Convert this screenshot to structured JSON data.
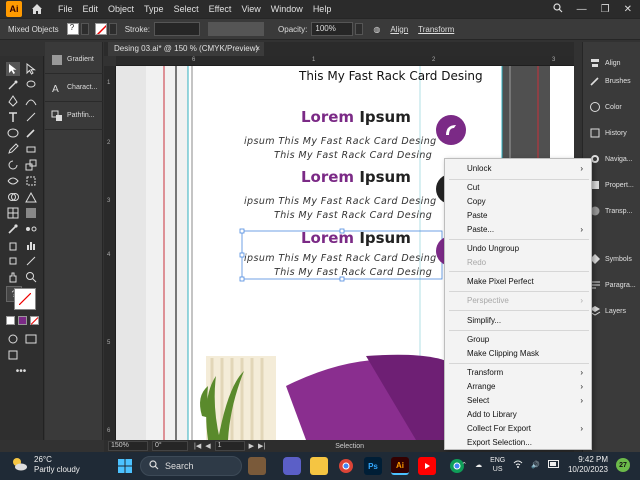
{
  "app": {
    "logo_text": "Ai",
    "menu": [
      "File",
      "Edit",
      "Object",
      "Type",
      "Select",
      "Effect",
      "View",
      "Window",
      "Help"
    ]
  },
  "controlbar": {
    "selection_label": "Mixed Objects",
    "stroke_label": "Stroke:",
    "opacity_label": "Opacity:",
    "opacity_value": "100%",
    "align_label": "Align",
    "transform_label": "Transform"
  },
  "left_panel": {
    "items": [
      "Gradient",
      "Charact...",
      "Pathfin..."
    ]
  },
  "document": {
    "tab_title": "Desing 03.ai* @ 150 % (CMYK/Preview)",
    "tab_close": "×",
    "ruler_top": [
      "6",
      "1",
      "2",
      "3"
    ],
    "ruler_left": [
      "1",
      "2",
      "3",
      "4",
      "5",
      "6"
    ]
  },
  "artboard": {
    "header": "This My Fast Rack Card Desing",
    "sections": [
      {
        "title_a": "Lorem",
        "title_b": "Ipsum",
        "line1": "ipsum This My Fast Rack Card Desing",
        "line2": "This My Fast Rack Card Desing"
      },
      {
        "title_a": "Lorem",
        "title_b": "Ipsum",
        "line1": "ipsum This My Fast Rack Card Desing",
        "line2": "This My Fast Rack Card Desing"
      },
      {
        "title_a": "Lorem",
        "title_b": "Ipsum",
        "line1": "ipsum This My Fast Rack Card Desing",
        "line2": "This My Fast Rack Card Desing"
      }
    ],
    "accent_color": "#7b2a86"
  },
  "statusbar": {
    "zoom": "150%",
    "rotation": "0°",
    "artboard_num": "1",
    "mode": "Selection"
  },
  "right_panel": {
    "items": [
      "Align",
      "Brushes",
      "Color",
      "History",
      "Naviga...",
      "Propert...",
      "Transp...",
      "Symbols",
      "Paragra...",
      "Layers"
    ]
  },
  "context_menu": {
    "items": [
      {
        "label": "Unlock",
        "submenu": true,
        "disabled": false
      },
      {
        "label": "Cut",
        "submenu": false,
        "disabled": false
      },
      {
        "label": "Copy",
        "submenu": false,
        "disabled": false
      },
      {
        "label": "Paste",
        "submenu": false,
        "disabled": false
      },
      {
        "label": "Paste...",
        "submenu": true,
        "disabled": false
      },
      {
        "label": "Undo Ungroup",
        "submenu": false,
        "disabled": false
      },
      {
        "label": "Redo",
        "submenu": false,
        "disabled": true
      },
      {
        "label": "Make Pixel Perfect",
        "submenu": false,
        "disabled": false
      },
      {
        "label": "Perspective",
        "submenu": true,
        "disabled": true
      },
      {
        "label": "Simplify...",
        "submenu": false,
        "disabled": false
      },
      {
        "label": "Group",
        "submenu": false,
        "disabled": false
      },
      {
        "label": "Make Clipping Mask",
        "submenu": false,
        "disabled": false
      },
      {
        "label": "Transform",
        "submenu": true,
        "disabled": false
      },
      {
        "label": "Arrange",
        "submenu": true,
        "disabled": false
      },
      {
        "label": "Select",
        "submenu": true,
        "disabled": false
      },
      {
        "label": "Add to Library",
        "submenu": false,
        "disabled": false
      },
      {
        "label": "Collect For Export",
        "submenu": true,
        "disabled": false
      },
      {
        "label": "Export Selection...",
        "submenu": false,
        "disabled": false
      }
    ]
  },
  "taskbar": {
    "temperature": "26°C",
    "weather": "Partly cloudy",
    "search_label": "Search",
    "lang_top": "ENG",
    "lang_bottom": "US",
    "time": "9:42 PM",
    "date": "10/20/2023",
    "badge_count": "27"
  }
}
